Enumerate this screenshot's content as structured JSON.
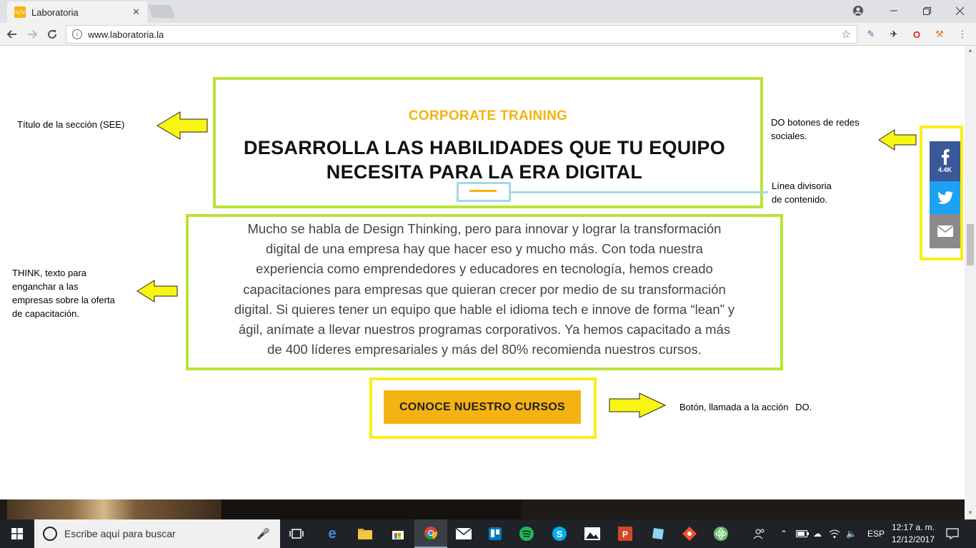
{
  "browser": {
    "tab_title": "Laboratoria",
    "tab_close": "✕",
    "url": "www.laboratoria.la"
  },
  "section": {
    "kicker": "CORPORATE TRAINING",
    "headline_line1": "DESARROLLA LAS HABILIDADES QUE TU EQUIPO",
    "headline_line2": "NECESITA PARA LA ERA DIGITAL",
    "body_lines": [
      "Mucho se habla de Design Thinking, pero para innovar y lograr la transformación",
      "digital de una empresa hay que hacer eso y mucho más. Con toda nuestra",
      "experiencia como emprendedores y educadores en tecnología, hemos creado",
      "capacitaciones para empresas que quieran crecer por medio de su transformación",
      "digital. Si quieres tener un equipo que hable el idioma tech e innove de forma “lean” y",
      "ágil, anímate a llevar nuestros programas corporativos. Ya hemos capacitado a más",
      "de 400 líderes empresariales y más del 80% recomienda nuestros cursos."
    ],
    "cta_label": "CONOCE NUESTRO CURSOS"
  },
  "annotations": {
    "title_note": "Título de la sección (SEE)",
    "social_note_line1": "DO botones de redes",
    "social_note_line2": "sociales.",
    "divider_note_line1": "Línea divisoria",
    "divider_note_line2": "de contenido.",
    "think_note_line1": "THINK, texto para",
    "think_note_line2": "enganchar a las",
    "think_note_line3": "empresas sobre la oferta",
    "think_note_line4": "de capacitación.",
    "button_note": "Botón, llamada a la acción",
    "button_note_do": "DO."
  },
  "share": {
    "facebook_count": "4.4K"
  },
  "taskbar": {
    "search_placeholder": "Escribe aquí para buscar",
    "language": "ESP",
    "time": "12:17 a. m.",
    "date": "12/12/2017"
  },
  "colors": {
    "brand_yellow": "#f5b213",
    "highlight_green": "#b8e436",
    "highlight_yellow": "#f9ee15",
    "highlight_blue": "#a4d8e6",
    "facebook": "#3b5998",
    "twitter": "#1da1f2",
    "email": "#8a8a8a"
  }
}
